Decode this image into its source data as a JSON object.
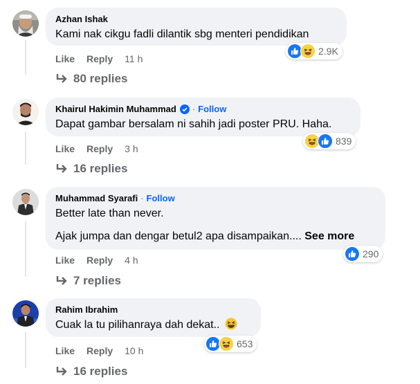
{
  "comments": [
    {
      "author": "Azhan Ishak",
      "verified": false,
      "follow": "",
      "text": "Kami nak cikgu fadli dilantik sbg menteri pendidikan",
      "text2": "",
      "see_more": "",
      "like": "Like",
      "reply": "Reply",
      "time": "11 h",
      "reaction_icons": [
        "like-icon",
        "haha-icon"
      ],
      "reaction_count": "2.9K",
      "replies": "80 replies"
    },
    {
      "author": "Khairul Hakimin Muhammad",
      "verified": true,
      "follow": "Follow",
      "text": "Dapat gambar bersalam ni sahih jadi poster PRU. Haha.",
      "text2": "",
      "see_more": "",
      "like": "Like",
      "reply": "Reply",
      "time": "3 h",
      "reaction_icons": [
        "haha-icon",
        "like-icon"
      ],
      "reaction_count": "839",
      "replies": "16 replies"
    },
    {
      "author": "Muhammad Syarafi",
      "verified": false,
      "follow": "Follow",
      "text": "Better late than never.",
      "text2": "Ajak jumpa dan dengar betul2 apa disampaikan....",
      "see_more": "See more",
      "like": "Like",
      "reply": "Reply",
      "time": "4 h",
      "reaction_icons": [
        "like-icon"
      ],
      "reaction_count": "290",
      "replies": "7 replies"
    },
    {
      "author": "Rahim Ibrahim",
      "verified": false,
      "follow": "",
      "text": "Cuak la tu pilihanraya dah dekat..",
      "text2": "",
      "see_more": "",
      "emoji_inline": "laughing-emoji-icon",
      "like": "Like",
      "reply": "Reply",
      "time": "10 h",
      "reaction_icons": [
        "like-icon",
        "haha-icon"
      ],
      "reaction_count": "653",
      "replies": "16 replies"
    }
  ],
  "colors": {
    "bubble": "#f0f2f5",
    "secondary_text": "#65676b",
    "follow_blue": "#0866ff",
    "like_blue": "#1877f2",
    "haha_yellow": "#f7d147"
  }
}
